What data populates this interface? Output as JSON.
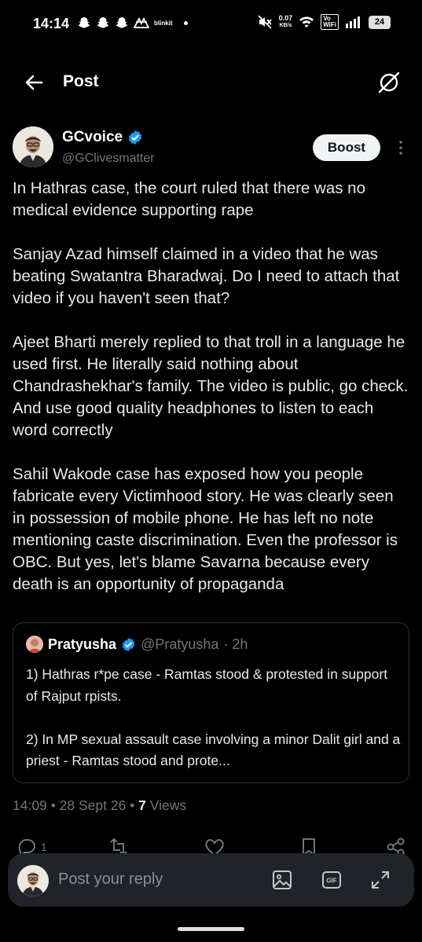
{
  "status_bar": {
    "time": "14:14",
    "notif_app": "blinkit",
    "net_speed_value": "0.07",
    "net_speed_unit": "KB/s",
    "vowifi_top": "Vo",
    "vowifi_bottom": "WiFi",
    "battery": "24"
  },
  "header": {
    "title": "Post",
    "back_icon": "arrow-left-icon",
    "grok_icon": "grok-icon"
  },
  "post": {
    "author_name": "GCvoice",
    "author_handle": "@GClivesmatter",
    "verified": true,
    "boost_label": "Boost",
    "paragraphs": [
      "In Hathras case, the court ruled that there was no medical evidence supporting rape",
      "Sanjay Azad himself claimed in a video that he was beating Swatantra Bharadwaj. Do I need to attach that video if you haven't seen that?",
      "Ajeet Bharti merely replied to that troll in a language he used first. He literally said nothing about Chandrashekhar's family. The video is public, go check. And use good quality headphones to listen to each word correctly",
      "Sahil Wakode case has exposed how you people fabricate every Victimhood story. He was clearly seen in possession of mobile phone. He has left no note mentioning caste discrimination. Even the professor is OBC. But yes, let's blame Savarna because every death is an opportunity of propaganda"
    ],
    "timestamp": "14:09 • 28 Sept 26 • ",
    "views_count": "7",
    "views_label": " Views",
    "reply_count": "1"
  },
  "quote": {
    "author_name": "Pratyusha",
    "author_handle": "@Pratyusha",
    "time": "· 2h",
    "paragraphs": [
      "1) Hathras r*pe case - Ramtas stood & protested in support of Rajput rpists.",
      "2) In MP sexual assault case involving a minor Dalit girl and a priest -  Ramtas stood and prote..."
    ]
  },
  "reply_bar": {
    "placeholder": "Post your reply"
  },
  "colors": {
    "background": "#000000",
    "text": "#e7e9ea",
    "muted": "#71767b",
    "verified": "#1d9bf0",
    "border": "#2f3336",
    "reply_bar": "#202327"
  }
}
